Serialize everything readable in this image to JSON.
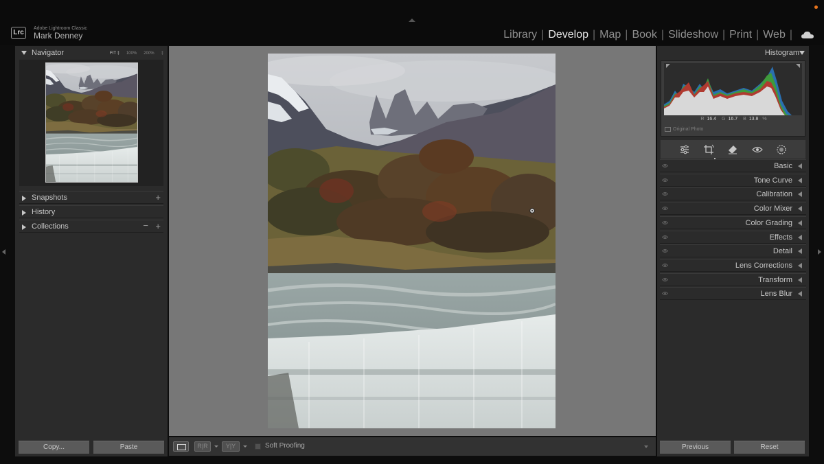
{
  "app": {
    "badge": "Lrc",
    "product": "Adobe Lightroom Classic",
    "user": "Mark Denney"
  },
  "modules": [
    {
      "label": "Library",
      "active": false
    },
    {
      "label": "Develop",
      "active": true
    },
    {
      "label": "Map",
      "active": false
    },
    {
      "label": "Book",
      "active": false
    },
    {
      "label": "Slideshow",
      "active": false
    },
    {
      "label": "Print",
      "active": false
    },
    {
      "label": "Web",
      "active": false
    }
  ],
  "module_separator": "|",
  "left_panel": {
    "navigator": {
      "title": "Navigator",
      "zoom_options": [
        "FIT ‡",
        "100%",
        "200%",
        "‡"
      ],
      "active_zoom": "FIT ‡"
    },
    "sections": [
      {
        "label": "Snapshots",
        "has_plus": true,
        "has_minus": false
      },
      {
        "label": "History",
        "has_plus": false,
        "has_minus": false
      },
      {
        "label": "Collections",
        "has_plus": true,
        "has_minus": true
      }
    ],
    "plus_glyph": "+",
    "minus_glyph": "−"
  },
  "right_panel": {
    "histogram": {
      "title": "Histogram",
      "r_label": "R",
      "r_value": "16.4",
      "g_label": "G",
      "g_value": "16.7",
      "b_label": "B",
      "b_value": "13.8",
      "unit": "%",
      "original_photo_label": "Original Photo"
    },
    "tools": [
      "sliders-icon",
      "crop-rotate-icon",
      "eraser-icon",
      "red-eye-icon",
      "masking-icon"
    ],
    "develop_panels": [
      "Basic",
      "Tone Curve",
      "Calibration",
      "Color Mixer",
      "Color Grading",
      "Effects",
      "Detail",
      "Lens Corrections",
      "Transform",
      "Lens Blur"
    ]
  },
  "bottom": {
    "copy_label": "Copy...",
    "paste_label": "Paste",
    "previous_label": "Previous",
    "reset_label": "Reset",
    "compare_label": "R|R",
    "yy_label": "Y|Y",
    "soft_proofing_label": "Soft Proofing"
  },
  "colors": {
    "accent_dot": "#e8741c",
    "panel_bg": "#2b2b2b",
    "canvas_bg": "#777777"
  }
}
